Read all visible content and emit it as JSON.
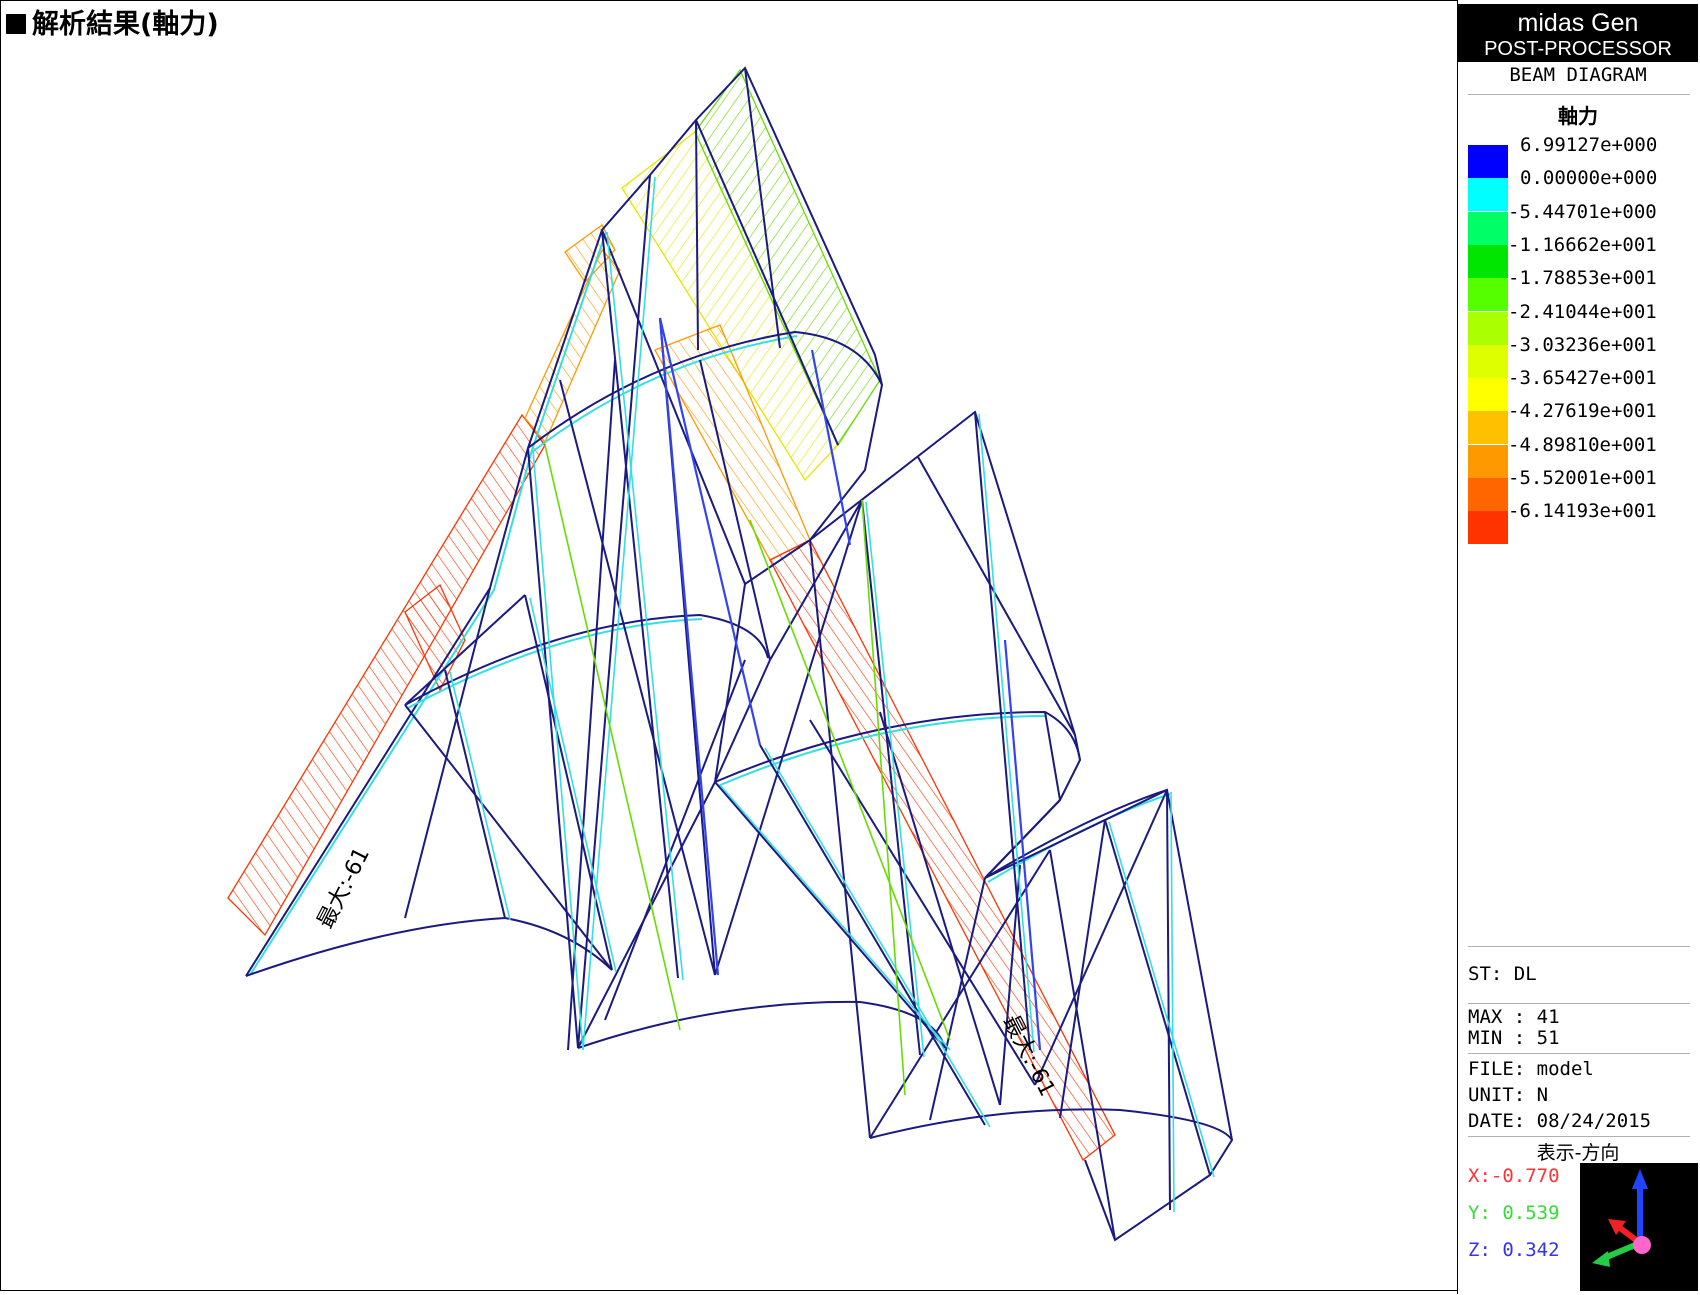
{
  "title": "解析結果(軸力)",
  "brand": {
    "line1": "midas Gen",
    "line2": "POST-PROCESSOR"
  },
  "diagram_type": "BEAM DIAGRAM",
  "component": "軸力",
  "legend": [
    {
      "value": "6.99127e+000",
      "color": "#0000ff"
    },
    {
      "value": "0.00000e+000",
      "color": "#00ffff"
    },
    {
      "value": "-5.44701e+000",
      "color": "#00ff66"
    },
    {
      "value": "-1.16662e+001",
      "color": "#00e600"
    },
    {
      "value": "-1.78853e+001",
      "color": "#55ff00"
    },
    {
      "value": "-2.41044e+001",
      "color": "#aaff00"
    },
    {
      "value": "-3.03236e+001",
      "color": "#ddff00"
    },
    {
      "value": "-3.65427e+001",
      "color": "#ffff00"
    },
    {
      "value": "-4.27619e+001",
      "color": "#ffc000"
    },
    {
      "value": "-4.89810e+001",
      "color": "#ff9900"
    },
    {
      "value": "-5.52001e+001",
      "color": "#ff6600"
    },
    {
      "value": "-6.14193e+001",
      "color": "#ff3300"
    }
  ],
  "info": {
    "st": "ST: DL",
    "max": "MAX : 41",
    "min": "MIN : 51",
    "file": "FILE: model",
    "unit": "UNIT: N",
    "date": "DATE: 08/24/2015"
  },
  "direction": {
    "title": "表示-方向",
    "x": "X:-0.770",
    "y": "Y: 0.539",
    "z": "Z: 0.342",
    "x_color": "#ff3333",
    "y_color": "#33dd33",
    "z_color": "#3333ff"
  },
  "labels": {
    "max_left": "最大:-61",
    "max_right": "最大:-61"
  }
}
